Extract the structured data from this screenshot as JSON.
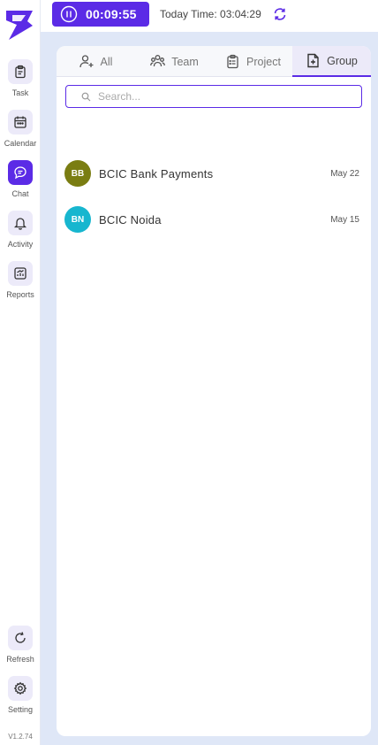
{
  "header": {
    "timer": "00:09:55",
    "today_time": "Today Time: 03:04:29"
  },
  "sidebar": {
    "items": [
      {
        "label": "Task",
        "icon": "clipboard-icon"
      },
      {
        "label": "Calendar",
        "icon": "calendar-icon"
      },
      {
        "label": "Chat",
        "icon": "chat-icon",
        "active": true
      },
      {
        "label": "Activity",
        "icon": "bell-icon"
      },
      {
        "label": "Reports",
        "icon": "chart-icon"
      }
    ],
    "refresh_label": "Refresh",
    "setting_label": "Setting",
    "version": "V1.2.74"
  },
  "tabs": [
    {
      "label": "All",
      "icon": "user-plus-icon"
    },
    {
      "label": "Team",
      "icon": "users-icon"
    },
    {
      "label": "Project",
      "icon": "clipboard-list-icon"
    },
    {
      "label": "Group",
      "icon": "file-plus-icon",
      "active": true
    }
  ],
  "search": {
    "placeholder": "Search..."
  },
  "chats": [
    {
      "initials": "BB",
      "name": "BCIC Bank Payments",
      "date": "May 22",
      "color": "#7a7d12"
    },
    {
      "initials": "BN",
      "name": "BCIC Noida",
      "date": "May 15",
      "color": "#17b6cf"
    }
  ],
  "colors": {
    "accent": "#5b2be6",
    "accent_light": "#eceaf9",
    "background": "#dfe7f7"
  }
}
